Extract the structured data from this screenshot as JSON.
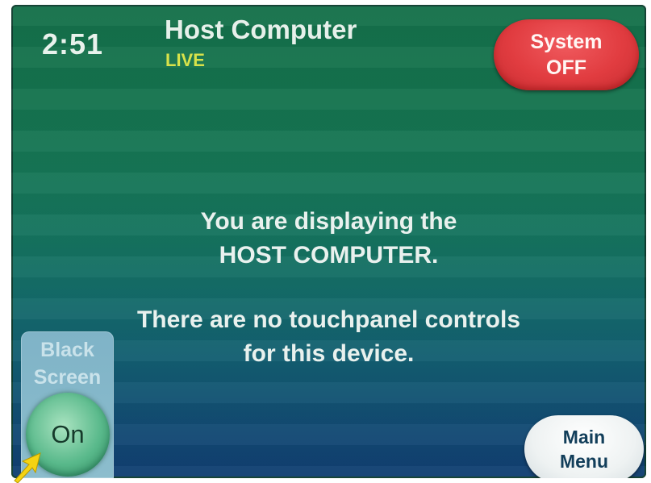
{
  "header": {
    "clock": "2:51",
    "title": "Host Computer",
    "status": "LIVE",
    "system_button": {
      "line1": "System",
      "line2": "OFF"
    }
  },
  "message": {
    "line1": "You are displaying the",
    "line2": "HOST COMPUTER.",
    "line3": "There are no touchpanel controls",
    "line4": "for this device."
  },
  "black_screen": {
    "label_line1": "Black",
    "label_line2": "Screen",
    "button_label": "On"
  },
  "main_menu": {
    "line1": "Main",
    "line2": "Menu"
  },
  "icons": {
    "pointer": "arrow-pointer-icon"
  },
  "colors": {
    "system_off": "#e13c40",
    "live": "#d8e24a",
    "pointer": "#f5d312"
  }
}
